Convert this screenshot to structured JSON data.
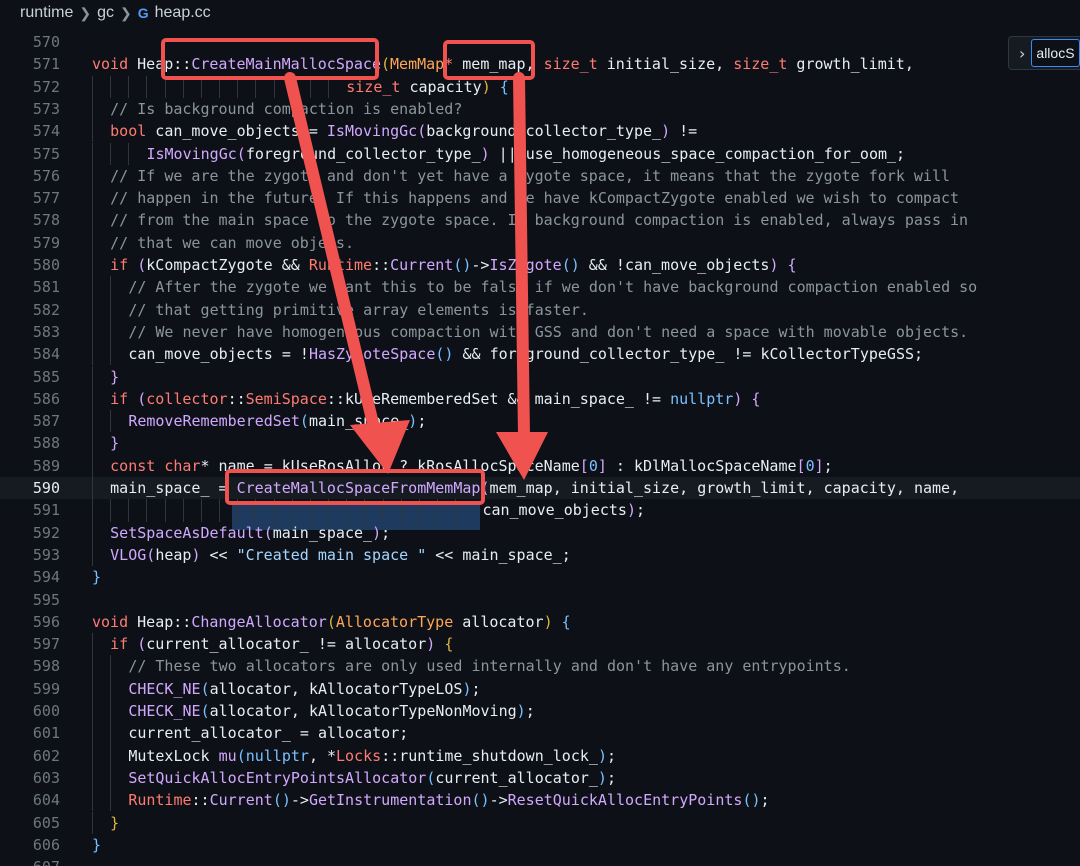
{
  "breadcrumb": {
    "items": [
      "runtime",
      "gc",
      "heap.cc"
    ],
    "cpp_icon": "G"
  },
  "find_widget": {
    "value": "allocS"
  },
  "colors": {
    "annotation": "#f0524f",
    "selection": "#1f3a5f",
    "background": "#0d1117"
  },
  "lines": [
    {
      "n": "570",
      "tokens": []
    },
    {
      "n": "571",
      "tokens": [
        [
          "kw",
          "void "
        ],
        [
          "id",
          "Heap"
        ],
        [
          "pun",
          "::"
        ],
        [
          "fn",
          "CreateMainMallocSpace"
        ],
        [
          "br",
          "("
        ],
        [
          "type",
          "MemMap"
        ],
        [
          "kw",
          "*"
        ],
        [
          "id",
          " mem_map"
        ],
        [
          "pun",
          ", "
        ],
        [
          "kw",
          "size_t"
        ],
        [
          "id",
          " initial_size"
        ],
        [
          "pun",
          ", "
        ],
        [
          "kw",
          "size_t"
        ],
        [
          "id",
          " growth_limit"
        ],
        [
          "pun",
          ","
        ]
      ]
    },
    {
      "n": "572",
      "indent": 28,
      "tokens": [
        [
          "kw",
          "size_t"
        ],
        [
          "id",
          " capacity"
        ],
        [
          "br",
          ")"
        ],
        [
          "pun",
          " "
        ],
        [
          "br3",
          "{"
        ]
      ]
    },
    {
      "n": "573",
      "indent": 2,
      "tokens": [
        [
          "cm",
          "// Is background compaction is enabled?"
        ]
      ]
    },
    {
      "n": "574",
      "indent": 2,
      "tokens": [
        [
          "kw",
          "bool"
        ],
        [
          "id",
          " can_move_objects "
        ],
        [
          "pun",
          "= "
        ],
        [
          "fn",
          "IsMovingGc"
        ],
        [
          "br2",
          "("
        ],
        [
          "id",
          "background_collector_type_"
        ],
        [
          "br2",
          ")"
        ],
        [
          "pun",
          " !="
        ]
      ]
    },
    {
      "n": "575",
      "indent": 6,
      "tokens": [
        [
          "fn",
          "IsMovingGc"
        ],
        [
          "br2",
          "("
        ],
        [
          "id",
          "foreground_collector_type_"
        ],
        [
          "br2",
          ")"
        ],
        [
          "pun",
          " || "
        ],
        [
          "id",
          "use_homogeneous_space_compaction_for_oom_"
        ],
        [
          "pun",
          ";"
        ]
      ]
    },
    {
      "n": "576",
      "indent": 2,
      "tokens": [
        [
          "cm",
          "// If we are the zygote and don't yet have a zygote space, it means that the zygote fork will"
        ]
      ]
    },
    {
      "n": "577",
      "indent": 2,
      "tokens": [
        [
          "cm",
          "// happen in the future. If this happens and we have kCompactZygote enabled we wish to compact"
        ]
      ]
    },
    {
      "n": "578",
      "indent": 2,
      "tokens": [
        [
          "cm",
          "// from the main space to the zygote space. If background compaction is enabled, always pass in"
        ]
      ]
    },
    {
      "n": "579",
      "indent": 2,
      "tokens": [
        [
          "cm",
          "// that we can move objets."
        ]
      ]
    },
    {
      "n": "580",
      "indent": 2,
      "tokens": [
        [
          "kw",
          "if"
        ],
        [
          "pun",
          " "
        ],
        [
          "br2",
          "("
        ],
        [
          "id",
          "kCompactZygote "
        ],
        [
          "pun",
          "&& "
        ],
        [
          "cls",
          "Runtime"
        ],
        [
          "pun",
          "::"
        ],
        [
          "fn",
          "Current"
        ],
        [
          "br3",
          "()"
        ],
        [
          "pun",
          "->"
        ],
        [
          "fn",
          "IsZygote"
        ],
        [
          "br3",
          "()"
        ],
        [
          "pun",
          " && !"
        ],
        [
          "id",
          "can_move_objects"
        ],
        [
          "br2",
          ")"
        ],
        [
          "pun",
          " "
        ],
        [
          "br2",
          "{"
        ]
      ]
    },
    {
      "n": "581",
      "indent": 4,
      "tokens": [
        [
          "cm",
          "// After the zygote we want this to be false if we don't have background compaction enabled so"
        ]
      ]
    },
    {
      "n": "582",
      "indent": 4,
      "tokens": [
        [
          "cm",
          "// that getting primitive array elements is faster."
        ]
      ]
    },
    {
      "n": "583",
      "indent": 4,
      "tokens": [
        [
          "cm",
          "// We never have homogeneous compaction with GSS and don't need a space with movable objects."
        ]
      ]
    },
    {
      "n": "584",
      "indent": 4,
      "tokens": [
        [
          "id",
          "can_move_objects "
        ],
        [
          "pun",
          "= !"
        ],
        [
          "fn",
          "HasZygoteSpace"
        ],
        [
          "br3",
          "()"
        ],
        [
          "pun",
          " && "
        ],
        [
          "id",
          "foreground_collector_type_ "
        ],
        [
          "pun",
          "!= "
        ],
        [
          "id",
          "kCollectorTypeGSS"
        ],
        [
          "pun",
          ";"
        ]
      ]
    },
    {
      "n": "585",
      "indent": 2,
      "tokens": [
        [
          "br2",
          "}"
        ]
      ]
    },
    {
      "n": "586",
      "indent": 2,
      "tokens": [
        [
          "kw",
          "if"
        ],
        [
          "pun",
          " "
        ],
        [
          "br2",
          "("
        ],
        [
          "cls",
          "collector"
        ],
        [
          "pun",
          "::"
        ],
        [
          "cls",
          "SemiSpace"
        ],
        [
          "pun",
          "::"
        ],
        [
          "id",
          "kUseRememberedSet "
        ],
        [
          "pun",
          "&& "
        ],
        [
          "id",
          "main_space_ "
        ],
        [
          "pun",
          "!= "
        ],
        [
          "num",
          "nullptr"
        ],
        [
          "br2",
          ")"
        ],
        [
          "pun",
          " "
        ],
        [
          "br2",
          "{"
        ]
      ]
    },
    {
      "n": "587",
      "indent": 4,
      "tokens": [
        [
          "fn",
          "RemoveRememberedSet"
        ],
        [
          "br3",
          "("
        ],
        [
          "id",
          "main_space_"
        ],
        [
          "br3",
          ")"
        ],
        [
          "pun",
          ";"
        ]
      ]
    },
    {
      "n": "588",
      "indent": 2,
      "tokens": [
        [
          "br2",
          "}"
        ]
      ]
    },
    {
      "n": "589",
      "indent": 2,
      "tokens": [
        [
          "kw",
          "const"
        ],
        [
          "pun",
          " "
        ],
        [
          "kw",
          "char"
        ],
        [
          "pun",
          "* "
        ],
        [
          "id",
          "name "
        ],
        [
          "pun",
          "= "
        ],
        [
          "id",
          "kUseRosAlloc "
        ],
        [
          "pun",
          "? "
        ],
        [
          "id",
          "kRosAllocSpaceName"
        ],
        [
          "br2",
          "["
        ],
        [
          "num",
          "0"
        ],
        [
          "br2",
          "]"
        ],
        [
          "pun",
          " : "
        ],
        [
          "id",
          "kDlMallocSpaceName"
        ],
        [
          "br2",
          "["
        ],
        [
          "num",
          "0"
        ],
        [
          "br2",
          "]"
        ],
        [
          "pun",
          ";"
        ]
      ]
    },
    {
      "n": "590",
      "indent": 2,
      "active": true,
      "tokens": [
        [
          "id",
          "main_space_ "
        ],
        [
          "pun",
          "= "
        ],
        [
          "fn",
          "CreateMallocSpaceFromMemMap"
        ],
        [
          "br2",
          "("
        ],
        [
          "id",
          "mem_map"
        ],
        [
          "pun",
          ", "
        ],
        [
          "id",
          "initial_size"
        ],
        [
          "pun",
          ", "
        ],
        [
          "id",
          "growth_limit"
        ],
        [
          "pun",
          ", "
        ],
        [
          "id",
          "capacity"
        ],
        [
          "pun",
          ", "
        ],
        [
          "id",
          "name"
        ],
        [
          "pun",
          ","
        ]
      ]
    },
    {
      "n": "591",
      "indent": 43,
      "tokens": [
        [
          "id",
          "can_move_objects"
        ],
        [
          "br2",
          ")"
        ],
        [
          "pun",
          ";"
        ]
      ]
    },
    {
      "n": "592",
      "indent": 2,
      "tokens": [
        [
          "fn",
          "SetSpaceAsDefault"
        ],
        [
          "br2",
          "("
        ],
        [
          "id",
          "main_space_"
        ],
        [
          "br2",
          ")"
        ],
        [
          "pun",
          ";"
        ]
      ]
    },
    {
      "n": "593",
      "indent": 2,
      "tokens": [
        [
          "fn",
          "VLOG"
        ],
        [
          "br2",
          "("
        ],
        [
          "id",
          "heap"
        ],
        [
          "br2",
          ")"
        ],
        [
          "pun",
          " << "
        ],
        [
          "str",
          "\"Created main space \""
        ],
        [
          "pun",
          " << "
        ],
        [
          "id",
          "main_space_"
        ],
        [
          "pun",
          ";"
        ]
      ]
    },
    {
      "n": "594",
      "tokens": [
        [
          "br3",
          "}"
        ]
      ]
    },
    {
      "n": "595",
      "tokens": []
    },
    {
      "n": "596",
      "tokens": [
        [
          "kw",
          "void "
        ],
        [
          "id",
          "Heap"
        ],
        [
          "pun",
          "::"
        ],
        [
          "fn",
          "ChangeAllocator"
        ],
        [
          "br",
          "("
        ],
        [
          "type",
          "AllocatorType"
        ],
        [
          "id",
          " allocator"
        ],
        [
          "br",
          ")"
        ],
        [
          "pun",
          " "
        ],
        [
          "br3",
          "{"
        ]
      ]
    },
    {
      "n": "597",
      "indent": 2,
      "tokens": [
        [
          "kw",
          "if"
        ],
        [
          "pun",
          " "
        ],
        [
          "br2",
          "("
        ],
        [
          "id",
          "current_allocator_ "
        ],
        [
          "pun",
          "!= "
        ],
        [
          "id",
          "allocator"
        ],
        [
          "br2",
          ")"
        ],
        [
          "pun",
          " "
        ],
        [
          "br",
          "{"
        ]
      ]
    },
    {
      "n": "598",
      "indent": 4,
      "tokens": [
        [
          "cm",
          "// These two allocators are only used internally and don't have any entrypoints."
        ]
      ]
    },
    {
      "n": "599",
      "indent": 4,
      "tokens": [
        [
          "fn",
          "CHECK_NE"
        ],
        [
          "br3",
          "("
        ],
        [
          "id",
          "allocator"
        ],
        [
          "pun",
          ", "
        ],
        [
          "id",
          "kAllocatorTypeLOS"
        ],
        [
          "br3",
          ")"
        ],
        [
          "pun",
          ";"
        ]
      ]
    },
    {
      "n": "600",
      "indent": 4,
      "tokens": [
        [
          "fn",
          "CHECK_NE"
        ],
        [
          "br3",
          "("
        ],
        [
          "id",
          "allocator"
        ],
        [
          "pun",
          ", "
        ],
        [
          "id",
          "kAllocatorTypeNonMoving"
        ],
        [
          "br3",
          ")"
        ],
        [
          "pun",
          ";"
        ]
      ]
    },
    {
      "n": "601",
      "indent": 4,
      "tokens": [
        [
          "id",
          "current_allocator_ "
        ],
        [
          "pun",
          "= "
        ],
        [
          "id",
          "allocator"
        ],
        [
          "pun",
          ";"
        ]
      ]
    },
    {
      "n": "602",
      "indent": 4,
      "tokens": [
        [
          "id",
          "MutexLock "
        ],
        [
          "fn",
          "mu"
        ],
        [
          "br3",
          "("
        ],
        [
          "num",
          "nullptr"
        ],
        [
          "pun",
          ", *"
        ],
        [
          "cls",
          "Locks"
        ],
        [
          "pun",
          "::"
        ],
        [
          "id",
          "runtime_shutdown_lock_"
        ],
        [
          "br3",
          ")"
        ],
        [
          "pun",
          ";"
        ]
      ]
    },
    {
      "n": "603",
      "indent": 4,
      "tokens": [
        [
          "fn",
          "SetQuickAllocEntryPointsAllocator"
        ],
        [
          "br3",
          "("
        ],
        [
          "id",
          "current_allocator_"
        ],
        [
          "br3",
          ")"
        ],
        [
          "pun",
          ";"
        ]
      ]
    },
    {
      "n": "604",
      "indent": 4,
      "tokens": [
        [
          "cls",
          "Runtime"
        ],
        [
          "pun",
          "::"
        ],
        [
          "fn",
          "Current"
        ],
        [
          "br3",
          "()"
        ],
        [
          "pun",
          "->"
        ],
        [
          "fn",
          "GetInstrumentation"
        ],
        [
          "br3",
          "()"
        ],
        [
          "pun",
          "->"
        ],
        [
          "fn",
          "ResetQuickAllocEntryPoints"
        ],
        [
          "br3",
          "()"
        ],
        [
          "pun",
          ";"
        ]
      ]
    },
    {
      "n": "605",
      "indent": 2,
      "tokens": [
        [
          "br",
          "}"
        ]
      ]
    },
    {
      "n": "606",
      "tokens": [
        [
          "br3",
          "}"
        ]
      ]
    },
    {
      "n": "607",
      "tokens": []
    }
  ]
}
